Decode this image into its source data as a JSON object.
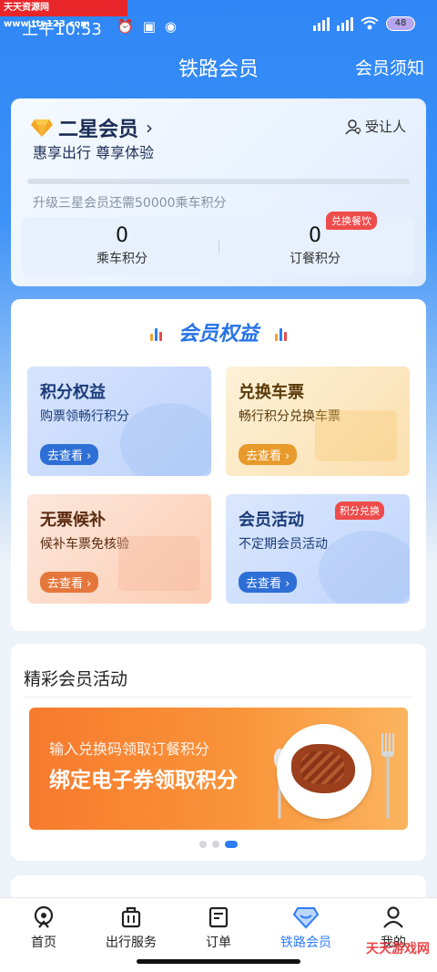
{
  "watermark_top": "天天资源网 www.tty123.com",
  "status": {
    "time": "上午10:53",
    "battery": "48"
  },
  "nav": {
    "title": "铁路会员",
    "right_link": "会员须知"
  },
  "member": {
    "tier": "二星会员",
    "slogan": "惠享出行 尊享体验",
    "assignee": "受让人",
    "progress": 0.0,
    "upgrade_text": "升级三星会员还需50000乘车积分",
    "ride_points_value": "0",
    "ride_points_label": "乘车积分",
    "meal_points_value": "0",
    "meal_points_label": "订餐积分",
    "exchange_badge": "兑换餐饮"
  },
  "benefits": {
    "title": "会员权益",
    "tiles": [
      {
        "title": "积分权益",
        "sub": "购票领畅行积分",
        "button": "去查看",
        "color": "#2e6fd6"
      },
      {
        "title": "兑换车票",
        "sub": "畅行积分兑换车票",
        "button": "去查看",
        "color": "#e89a2a"
      },
      {
        "title": "无票候补",
        "sub": "候补车票免核验",
        "button": "去查看",
        "color": "#e5773c"
      },
      {
        "title": "会员活动",
        "sub": "不定期会员活动",
        "button": "去查看",
        "color": "#2e6fd6",
        "badge": "积分兑换"
      }
    ]
  },
  "activities": {
    "title": "精彩会员活动",
    "banner_line1": "输入兑换码领取订餐积分",
    "banner_line2": "绑定电子券领取积分",
    "active_dot": 2
  },
  "tabbar": [
    {
      "label": "首页",
      "icon": "home-icon"
    },
    {
      "label": "出行服务",
      "icon": "luggage-icon"
    },
    {
      "label": "订单",
      "icon": "order-icon"
    },
    {
      "label": "铁路会员",
      "icon": "diamond-icon",
      "active": true
    },
    {
      "label": "我的",
      "icon": "user-icon"
    }
  ],
  "watermark_bottom": "天天游戏网"
}
